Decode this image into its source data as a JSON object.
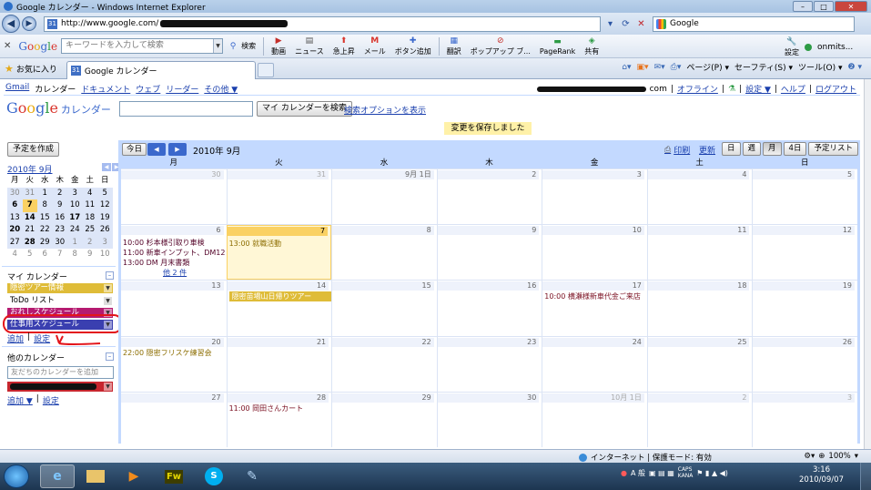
{
  "window": {
    "title": "Google カレンダー - Windows Internet Explorer",
    "address": "http://www.google.com/",
    "search_engine": "Google"
  },
  "google_toolbar": {
    "search_placeholder": "キーワードを入力して検索",
    "search_label": "検索",
    "items": [
      "動画",
      "ニュース",
      "急上昇",
      "メール",
      "ボタン追加",
      "翻訳",
      "ポップアップ ブ...",
      "PageRank",
      "共有"
    ],
    "settings": "設定",
    "user": "onmits..."
  },
  "favbar": {
    "favorites": "お気に入り",
    "tab_title": "Google カレンダー",
    "cmd_page": "ページ(P) ▾",
    "cmd_safety": "セーフティ(S) ▾",
    "cmd_tools": "ツール(O) ▾",
    "cmd_help": "❷ ▾"
  },
  "gbar": {
    "links": [
      "Gmail",
      "ドキュメント",
      "ウェブ",
      "リーダー",
      "その他 ▼"
    ],
    "current": "カレンダー",
    "user_suffix": "com",
    "offline": "オフライン",
    "settings": "設定 ▼",
    "help": "ヘルプ",
    "logout": "ログアウト"
  },
  "header": {
    "logo_suffix": "カレンダー",
    "search_button": "マイ カレンダーを検索",
    "search_options": "検索オプションを表示",
    "saved_message": "変更を保存しました"
  },
  "sidebar": {
    "create_button": "予定を作成",
    "mini_month": "2010年 9月",
    "mini_dow": [
      "月",
      "火",
      "水",
      "木",
      "金",
      "土",
      "日"
    ],
    "mini_weeks": [
      [
        "30",
        "31",
        "1",
        "2",
        "3",
        "4",
        "5"
      ],
      [
        "6",
        "7",
        "8",
        "9",
        "10",
        "11",
        "12"
      ],
      [
        "13",
        "14",
        "15",
        "16",
        "17",
        "18",
        "19"
      ],
      [
        "20",
        "21",
        "22",
        "23",
        "24",
        "25",
        "26"
      ],
      [
        "27",
        "28",
        "29",
        "30",
        "1",
        "2",
        "3"
      ],
      [
        "4",
        "5",
        "6",
        "7",
        "8",
        "9",
        "10"
      ]
    ],
    "my_calendars_title": "マイ カレンダー",
    "my_calendars": [
      {
        "label": "隠密ツアー情報",
        "color": "#dfbc38"
      },
      {
        "label": "ToDo リスト",
        "color": "#ffffff"
      },
      {
        "label": "おれしスケジュール",
        "color": "#b51a70"
      },
      {
        "label": "仕事用スケジュール",
        "color": "#3a3fb0"
      }
    ],
    "my_links": [
      "追加",
      "設定"
    ],
    "other_calendars_title": "他のカレンダー",
    "add_friend_placeholder": "友だちのカレンダーを追加",
    "other_links": [
      "追加 ▼",
      "設定"
    ]
  },
  "calendar": {
    "today_button": "今日",
    "month_label": "2010年 9月",
    "print": "印刷",
    "refresh": "更新",
    "views": [
      "日",
      "週",
      "月",
      "4日",
      "予定リスト"
    ],
    "active_view": "月",
    "dow": [
      "月",
      "火",
      "水",
      "木",
      "金",
      "土",
      "日"
    ],
    "weeks": [
      [
        "30",
        "31",
        "9月 1日",
        "2",
        "3",
        "4",
        "5"
      ],
      [
        "6",
        "7",
        "8",
        "9",
        "10",
        "11",
        "12"
      ],
      [
        "13",
        "14",
        "15",
        "16",
        "17",
        "18",
        "19"
      ],
      [
        "20",
        "21",
        "22",
        "23",
        "24",
        "25",
        "26"
      ],
      [
        "27",
        "28",
        "29",
        "30",
        "10月 1日",
        "2",
        "3"
      ]
    ],
    "events": {
      "mon6_1": "10:00 杉本様引取り車検",
      "mon6_2": "11:00 新車インプット、DM120作",
      "mon6_3": "13:00 DM 月末書類",
      "mon6_more": "他 2 件",
      "tue7_1": "13:00 就職活動",
      "tue14_bar": "隠密苗場山日帰りツアー",
      "fri17_1": "10:00 横瀬様新車代金ご来店",
      "mon20_1": "22:00 隠密フリスケ練習会",
      "tue28_1": "11:00 岡田さんカート"
    }
  },
  "statusbar": {
    "zone": "インターネット | 保護モード: 有効",
    "zoom": "100%"
  },
  "taskbar": {
    "ime": "A 般",
    "time": "3:16",
    "date": "2010/09/07"
  }
}
